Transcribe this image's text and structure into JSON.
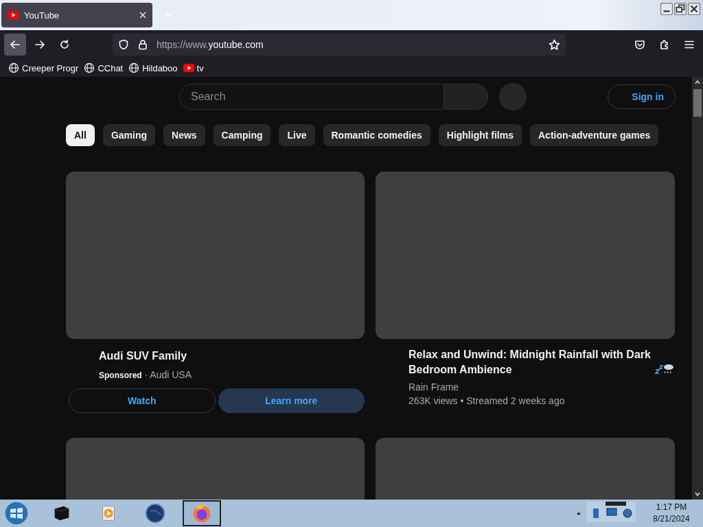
{
  "browser": {
    "tabs": [
      {
        "title": "YouTube",
        "selected": true
      }
    ],
    "url": {
      "prefix": "https://www.",
      "host": "youtube.com"
    },
    "bookmarks": [
      {
        "label": "Creeper Progr",
        "kind": "globe"
      },
      {
        "label": "CChat",
        "kind": "globe"
      },
      {
        "label": "Hildaboo",
        "kind": "globe"
      },
      {
        "label": "tv",
        "kind": "youtube"
      }
    ]
  },
  "page": {
    "search": {
      "placeholder": "Search"
    },
    "sign_in": "Sign in",
    "chips": [
      {
        "label": "All",
        "selected": true
      },
      {
        "label": "Gaming",
        "selected": false
      },
      {
        "label": "News",
        "selected": false
      },
      {
        "label": "Camping",
        "selected": false
      },
      {
        "label": "Live",
        "selected": false
      },
      {
        "label": "Romantic comedies",
        "selected": false
      },
      {
        "label": "Highlight films",
        "selected": false
      },
      {
        "label": "Action-adventure games",
        "selected": false
      }
    ],
    "videos": [
      {
        "kind": "ad",
        "title": "Audi SUV Family",
        "byline": "**Sponsored** · Audi USA",
        "buttons": [
          "Watch",
          "Learn more"
        ]
      },
      {
        "kind": "video",
        "title": "Relax and Unwind: Midnight Rainfall with Dark Bedroom Ambience",
        "channel": "Rain Frame",
        "meta": "263K views • Streamed 2 weeks ago"
      },
      {
        "kind": "placeholder"
      },
      {
        "kind": "placeholder"
      }
    ]
  },
  "taskbar": {
    "apps": [
      {
        "kind": "box",
        "active": false
      },
      {
        "kind": "media",
        "active": false
      },
      {
        "kind": "globe",
        "active": false
      },
      {
        "kind": "firefox",
        "active": true
      }
    ],
    "time": "1:17 PM",
    "date": "8/21/2024"
  }
}
